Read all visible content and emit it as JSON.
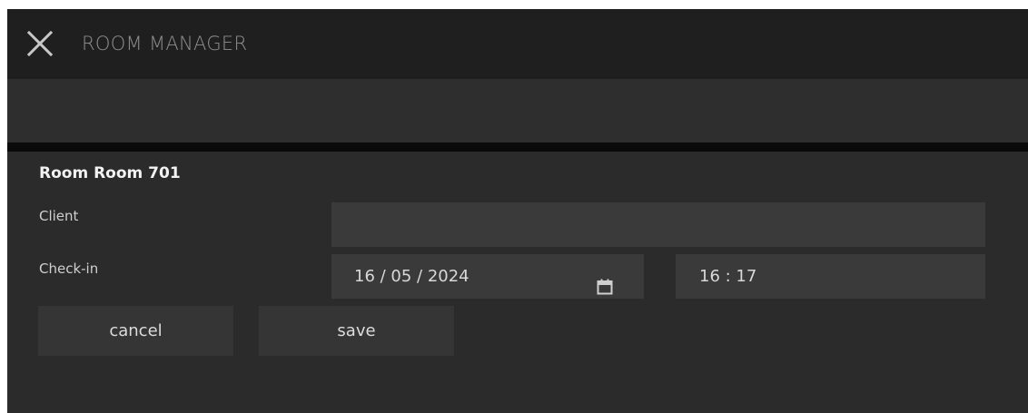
{
  "header": {
    "title": "ROOM MANAGER",
    "close_icon": "close-icon"
  },
  "form": {
    "room_title": "Room Room 701",
    "client_label": "Client",
    "client_value": "",
    "checkin_label": "Check-in",
    "checkin_date": "16 / 05 / 2024",
    "calendar_icon": "calendar-icon",
    "checkin_time": "16 : 17"
  },
  "actions": {
    "cancel_label": "cancel",
    "save_label": "save"
  },
  "colors": {
    "titlebar_bg": "#1f1f1f",
    "panel_bg": "#2b2b2b",
    "input_bg": "#3a3a3a",
    "divider": "#0a0a0a"
  }
}
